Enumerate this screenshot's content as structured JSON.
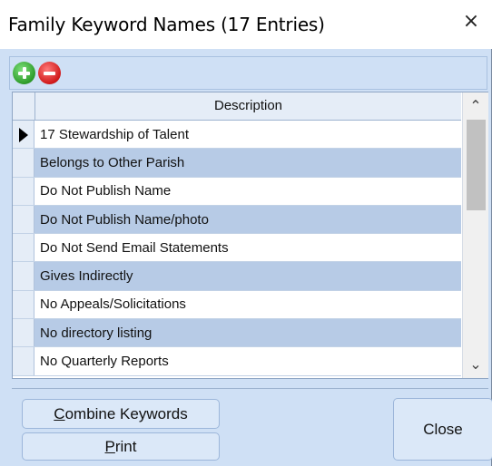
{
  "window": {
    "title": "Family Keyword Names (17 Entries)",
    "close_glyph": "×"
  },
  "toolbar": {
    "add_icon": "plus-circle-green",
    "remove_icon": "minus-circle-red"
  },
  "grid": {
    "column_header": "Description",
    "current_row_indicator": "▶",
    "rows": [
      "17 Stewardship of Talent",
      "Belongs to Other Parish",
      "Do Not Publish Name",
      "Do Not Publish Name/photo",
      "Do Not Send Email Statements",
      "Gives Indirectly",
      "No Appeals/Solicitations",
      "No directory listing",
      "No Quarterly Reports"
    ],
    "scroll_up_glyph": "⌃",
    "scroll_down_glyph": "⌄"
  },
  "buttons": {
    "combine_mnemonic": "C",
    "combine_rest": "ombine Keywords",
    "print_mnemonic": "P",
    "print_rest": "rint",
    "close": "Close"
  },
  "colors": {
    "window_bg": "#cfe0f5",
    "alt_row": "#b7cbe6",
    "add_green": "#2e9c2a",
    "remove_red": "#d0191a"
  }
}
